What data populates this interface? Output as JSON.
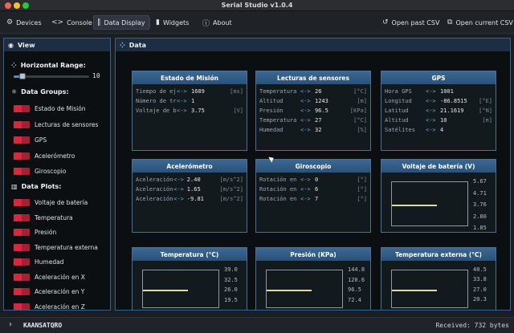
{
  "app": {
    "title": "Serial Studio v1.0.4"
  },
  "toolbar": {
    "devices": "Devices",
    "console": "Console",
    "data_display": "Data Display",
    "widgets": "Widgets",
    "about": "About",
    "open_past_csv": "Open past CSV",
    "open_current_csv": "Open current CSV"
  },
  "view": {
    "title": "View",
    "horizontal_range": {
      "label": "Horizontal Range:",
      "value": "10",
      "fraction": 0.12
    },
    "data_groups_title": "Data Groups:",
    "data_groups": [
      "Estado de Misión",
      "Lecturas de sensores",
      "GPS",
      "Acelerómetro",
      "Giroscopio"
    ],
    "data_plots_title": "Data Plots:",
    "data_plots": [
      "Voltaje de batería",
      "Temperatura",
      "Presión",
      "Temperatura externa",
      "Humedad",
      "Aceleración en X",
      "Aceleración en Y",
      "Aceleración en Z"
    ]
  },
  "data": {
    "title": "Data",
    "groups": [
      {
        "title": "Estado de Misión",
        "rows": [
          {
            "label": "Tiempo de eje",
            "value": "1689",
            "unit": "[ms]"
          },
          {
            "label": "Número de tra",
            "value": "1",
            "unit": ""
          },
          {
            "label": "Voltaje de ba",
            "value": "3.75",
            "unit": "[V]"
          }
        ]
      },
      {
        "title": "Lecturas de sensores",
        "rows": [
          {
            "label": "Temperatura",
            "value": "26",
            "unit": "[°C]"
          },
          {
            "label": "Altitud",
            "value": "1243",
            "unit": "[m]"
          },
          {
            "label": "Presión",
            "value": "96.5",
            "unit": "[KPa]"
          },
          {
            "label": "Temperatura e",
            "value": "27",
            "unit": "[°C]"
          },
          {
            "label": "Humedad",
            "value": "32",
            "unit": "[%]"
          }
        ]
      },
      {
        "title": "GPS",
        "rows": [
          {
            "label": "Hora GPS",
            "value": "1001",
            "unit": ""
          },
          {
            "label": "Longitud",
            "value": "-86.8515",
            "unit": "[°E]"
          },
          {
            "label": "Latitud",
            "value": "21.1619",
            "unit": "[°N]"
          },
          {
            "label": "Altitud",
            "value": "10",
            "unit": "[m]"
          },
          {
            "label": "Satélites",
            "value": "4",
            "unit": ""
          }
        ]
      },
      {
        "title": "Acelerómetro",
        "rows": [
          {
            "label": "Aceleración e",
            "value": "2.40",
            "unit": "[m/s^2]"
          },
          {
            "label": "Aceleración e",
            "value": "1.65",
            "unit": "[m/s^2]"
          },
          {
            "label": "Aceleración e",
            "value": "-9.81",
            "unit": "[m/s^2]"
          }
        ]
      },
      {
        "title": "Giroscopio",
        "rows": [
          {
            "label": "Rotación en X",
            "value": "0",
            "unit": "[°]"
          },
          {
            "label": "Rotación en Y",
            "value": "6",
            "unit": "[°]"
          },
          {
            "label": "Rotación en Z",
            "value": "7",
            "unit": "[°]"
          }
        ]
      }
    ],
    "plots": [
      {
        "title": "Voltaje de batería (V)",
        "ticks": [
          "5.67",
          "4.71",
          "3.76",
          "2.80",
          "1.85"
        ],
        "value": 3.75,
        "ymin": 1.85,
        "ymax": 5.67
      },
      {
        "title": "Temperatura (°C)",
        "ticks": [
          "39.0",
          "32.5",
          "26.0",
          "19.5"
        ],
        "value": 26,
        "ymin": 13.0,
        "ymax": 39.0
      },
      {
        "title": "Presión (KPa)",
        "ticks": [
          "144.8",
          "120.6",
          "96.5",
          "72.4"
        ],
        "value": 96.5,
        "ymin": 48.3,
        "ymax": 144.8
      },
      {
        "title": "Temperatura externa (°C)",
        "ticks": [
          "40.5",
          "33.8",
          "27.0",
          "20.3"
        ],
        "value": 27,
        "ymin": 13.5,
        "ymax": 40.5
      }
    ]
  },
  "footer": {
    "device": "KAANSATQRO",
    "received": "Received: 732 bytes"
  },
  "colors": {
    "accent": "#4a90d9",
    "toggle_on": "#d8283f",
    "widget_header": "#3b6894",
    "plot_line": "#e4dc8f"
  },
  "icons": {
    "devices": "sliders-icon",
    "console": "code-icon",
    "data_display": "waveform-icon",
    "widgets": "bar-chart-icon",
    "about": "info-icon",
    "open_past_csv": "history-icon",
    "open_current_csv": "external-link-icon"
  }
}
